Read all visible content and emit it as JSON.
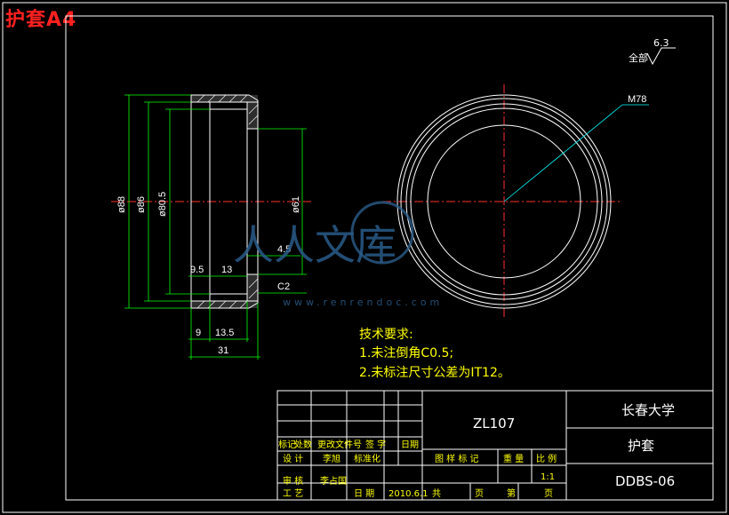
{
  "sheet_label": "护套A4",
  "roughness": {
    "label": "全部",
    "value": "6.3"
  },
  "dimensions": {
    "d88": "ø88",
    "d86": "ø86",
    "d80_5": "ø80.5",
    "d61": "ø61",
    "l4_5": "4.5",
    "l9_5": "9.5",
    "l13": "13",
    "chamfer": "C2",
    "l9": "9",
    "l13_5": "13.5",
    "l31": "31",
    "thread": "M78"
  },
  "tech_notes": {
    "title": "技术要求:",
    "items": [
      "1.未注倒角C0.5;",
      "2.未标注尺寸公差为IT12。"
    ]
  },
  "title_block": {
    "drawing_no": "ZL107",
    "school": "长春大学",
    "part_name": "护套",
    "code": "DDBS-06",
    "scale_value": "1:1",
    "headers": {
      "mark": "标记",
      "count": "处数",
      "change_doc": "更改文件号",
      "signature": "签 字",
      "date": "日期",
      "design": "设 计",
      "standardize": "标准化",
      "review": "审 核",
      "process": "工 艺",
      "date2": "日 期",
      "stage_mark": "图 样 标 记",
      "weight": "重 量",
      "scale": "比 例",
      "total": "共",
      "page": "页",
      "sheet_no": "第",
      "page2": "页"
    },
    "names": {
      "designer": "李旭",
      "reviewer": "李占国",
      "date": "2010.6.1"
    }
  },
  "watermark": {
    "text": "人人文库",
    "url": "www.renrendoc.com"
  }
}
